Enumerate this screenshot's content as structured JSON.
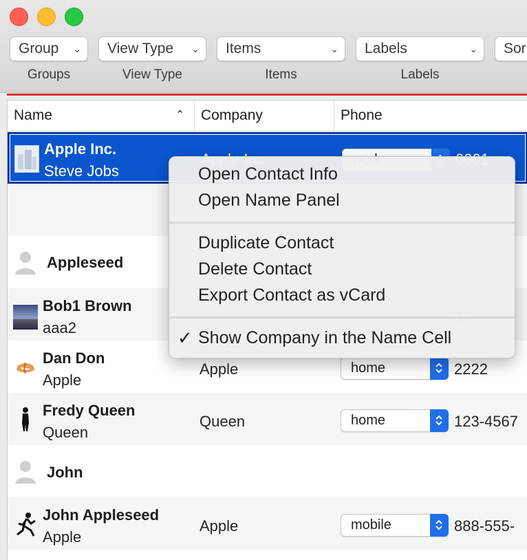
{
  "toolbar": {
    "controls": [
      {
        "value": "Group",
        "label": "Groups"
      },
      {
        "value": "View Type",
        "label": "View Type"
      },
      {
        "value": "Items",
        "label": "Items"
      },
      {
        "value": "Labels",
        "label": "Labels"
      },
      {
        "value": "Sor",
        "label": ""
      }
    ]
  },
  "table": {
    "columns": [
      "Name",
      "Company",
      "Phone"
    ],
    "rows": [
      {
        "name": "Apple Inc.",
        "sub": "Steve Jobs",
        "company": "Apple Inc.",
        "phone_type": "work",
        "phone": "0001"
      },
      {
        "name": "Appleseed"
      },
      {
        "name": "Bob1 Brown",
        "sub": "aaa2",
        "phone": "3-"
      },
      {
        "name": "Dan Don",
        "sub": "Apple",
        "company": "Apple",
        "phone_type": "home",
        "phone": "2222"
      },
      {
        "name": "Fredy Queen",
        "sub": "Queen",
        "company": "Queen",
        "phone_type": "home",
        "phone": "123-4567"
      },
      {
        "name": "John"
      },
      {
        "name": "John Appleseed",
        "sub": "Apple",
        "company": "Apple",
        "phone_type": "mobile",
        "phone": "888-555-"
      }
    ]
  },
  "context_menu": {
    "items": [
      "Open Contact Info",
      "Open Name Panel",
      "Duplicate Contact",
      "Delete Contact",
      "Export Contact as vCard",
      "Show Company in the Name Cell"
    ],
    "checkmark": "✓"
  },
  "colors": {
    "selection": "#0b55cf",
    "accent_line": "#e22b2b",
    "stepper": "#1f6fea"
  }
}
